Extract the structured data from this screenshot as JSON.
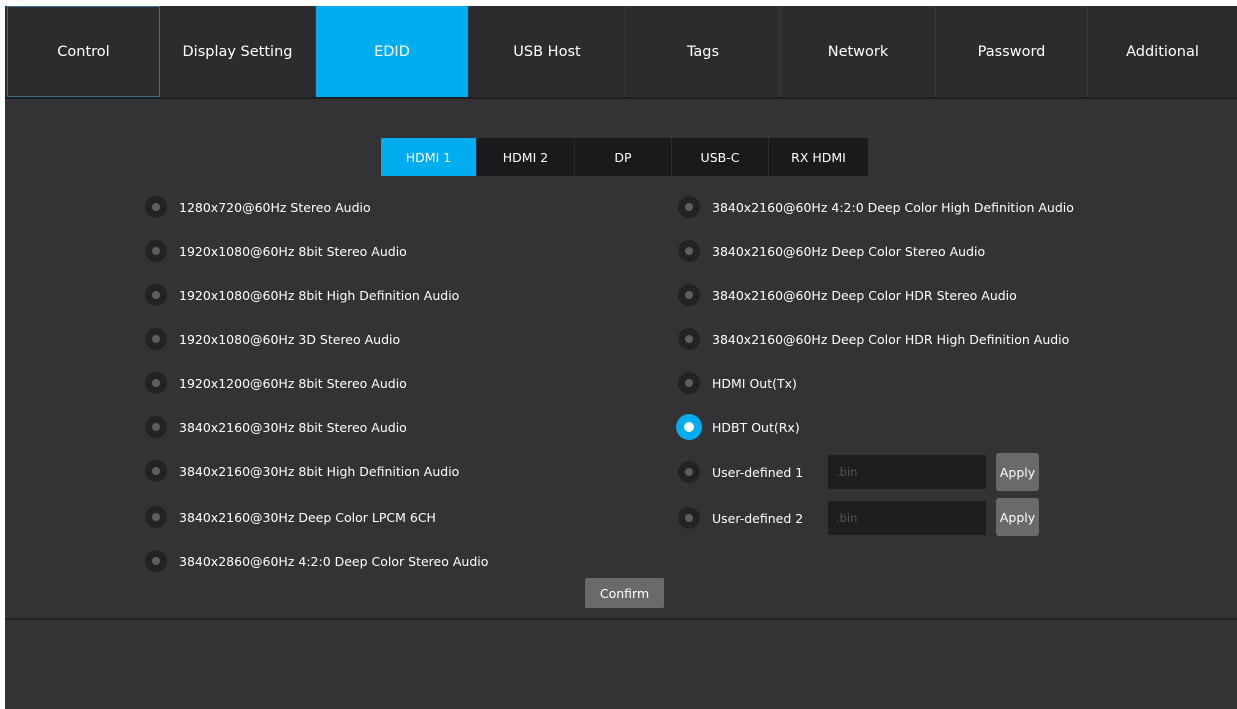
{
  "nav": {
    "tabs": [
      {
        "label": "Control"
      },
      {
        "label": "Display Setting"
      },
      {
        "label": "EDID"
      },
      {
        "label": "USB Host"
      },
      {
        "label": "Tags"
      },
      {
        "label": "Network"
      },
      {
        "label": "Password"
      },
      {
        "label": "Additional"
      }
    ],
    "active": "EDID"
  },
  "edid": {
    "sources": [
      {
        "label": "HDMI 1"
      },
      {
        "label": "HDMI 2"
      },
      {
        "label": "DP"
      },
      {
        "label": "USB-C"
      },
      {
        "label": "RX HDMI"
      }
    ],
    "active_source": "HDMI 1",
    "left_options": [
      {
        "label": "1280x720@60Hz Stereo Audio"
      },
      {
        "label": "1920x1080@60Hz 8bit Stereo Audio"
      },
      {
        "label": "1920x1080@60Hz 8bit High Definition Audio"
      },
      {
        "label": "1920x1080@60Hz 3D Stereo Audio"
      },
      {
        "label": "1920x1200@60Hz 8bit Stereo Audio"
      },
      {
        "label": "3840x2160@30Hz 8bit Stereo Audio"
      },
      {
        "label": "3840x2160@30Hz 8bit High Definition Audio"
      },
      {
        "label": "3840x2160@30Hz Deep Color LPCM 6CH"
      },
      {
        "label": "3840x2860@60Hz 4:2:0 Deep Color Stereo Audio"
      }
    ],
    "right_options": [
      {
        "label": "3840x2160@60Hz 4:2:0 Deep Color High Definition Audio"
      },
      {
        "label": "3840x2160@60Hz Deep Color Stereo Audio"
      },
      {
        "label": "3840x2160@60Hz Deep Color HDR Stereo Audio"
      },
      {
        "label": "3840x2160@60Hz Deep Color HDR High Definition Audio"
      },
      {
        "label": "HDMI Out(Tx)"
      },
      {
        "label": "HDBT Out(Rx)"
      }
    ],
    "selected": "HDBT Out(Rx)",
    "user_defined": [
      {
        "label": "User-defined 1",
        "value": "",
        "placeholder": ".bin",
        "apply_label": "Apply"
      },
      {
        "label": "User-defined 2",
        "value": "",
        "placeholder": ".bin",
        "apply_label": "Apply"
      }
    ],
    "confirm_label": "Confirm"
  },
  "colors": {
    "accent": "#00aeef",
    "background": "#333335",
    "nav_background": "#2c2c2e",
    "button": "#6a6a6c"
  }
}
